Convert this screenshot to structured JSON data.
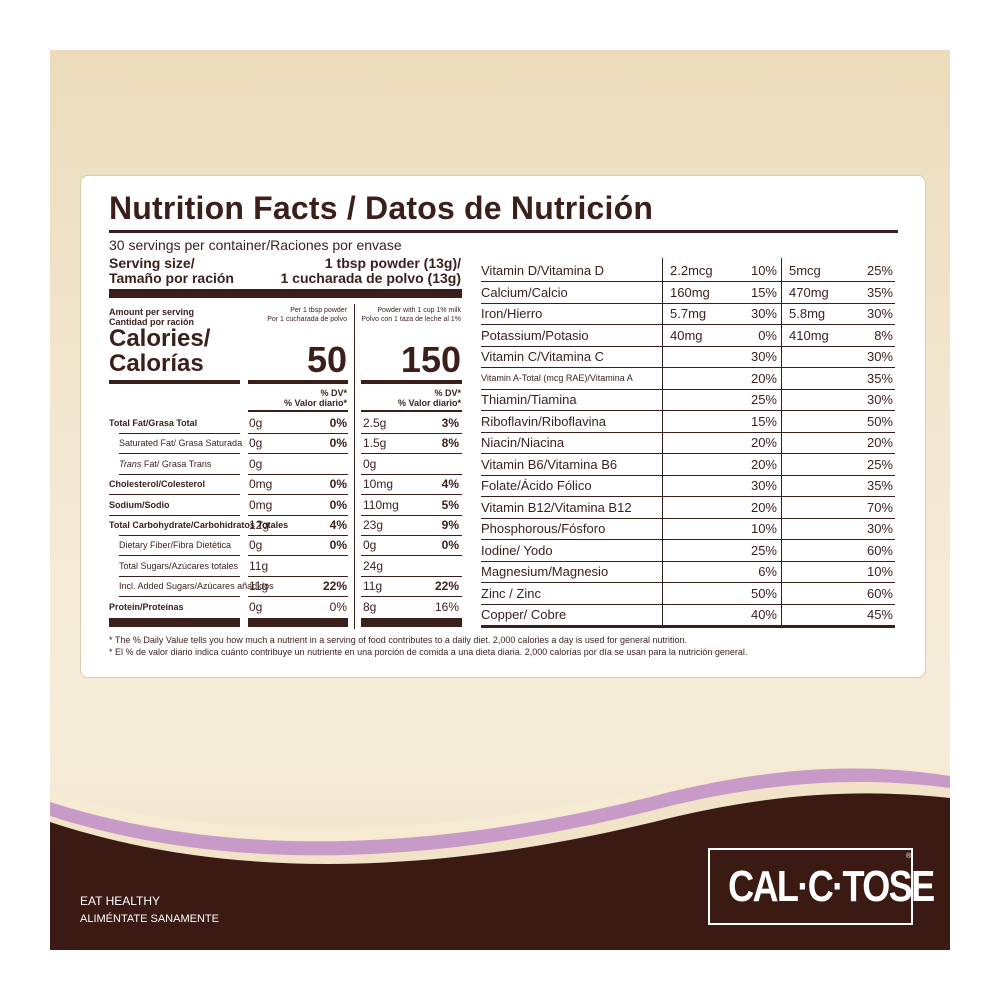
{
  "title": "Nutrition Facts / Datos de Nutrición",
  "servings": "30 servings per container/Raciones por envase",
  "serving_size_label": [
    "Serving size/",
    "Tamaño por ración"
  ],
  "serving_size_value": [
    "1 tbsp powder (13g)/",
    "1 cucharada de polvo (13g)"
  ],
  "amount_per_serving": [
    "Amount per serving",
    "Cantidad por ración"
  ],
  "col1_header": [
    "Per 1 tbsp powder",
    "Por 1 cucharada de polvo"
  ],
  "col2_header": [
    "Powder with 1 cup 1% milk",
    "Polvo con 1 taza de leche al 1%"
  ],
  "calories_label": [
    "Calories/",
    "Calorías"
  ],
  "calories": [
    "50",
    "150"
  ],
  "dv_header": [
    "% DV*",
    "% Valor diario*"
  ],
  "macros": [
    {
      "name": "Total Fat/Grasa Total",
      "bold": true,
      "indent": false,
      "v1": "0g",
      "p1": "0%",
      "v2": "2.5g",
      "p2": "3%",
      "pb": true
    },
    {
      "name": "Saturated Fat/ Grasa Saturada",
      "bold": false,
      "indent": true,
      "v1": "0g",
      "p1": "0%",
      "v2": "1.5g",
      "p2": "8%",
      "pb": true
    },
    {
      "name": "Trans Fat/ Grasa Trans",
      "bold": false,
      "indent": true,
      "v1": "0g",
      "p1": "",
      "v2": "0g",
      "p2": "",
      "pb": true
    },
    {
      "name": "Cholesterol/Colesterol",
      "bold": true,
      "indent": false,
      "v1": "0mg",
      "p1": "0%",
      "v2": "10mg",
      "p2": "4%",
      "pb": true
    },
    {
      "name": "Sodium/Sodio",
      "bold": true,
      "indent": false,
      "v1": "0mg",
      "p1": "0%",
      "v2": "110mg",
      "p2": "5%",
      "pb": true
    },
    {
      "name": "Total Carbohydrate/Carbohidratos Totales",
      "bold": true,
      "indent": false,
      "v1": "12g",
      "p1": "4%",
      "v2": "23g",
      "p2": "9%",
      "pb": true
    },
    {
      "name": "Dietary Fiber/Fibra Dietética",
      "bold": false,
      "indent": true,
      "v1": "0g",
      "p1": "0%",
      "v2": "0g",
      "p2": "0%",
      "pb": true
    },
    {
      "name": "Total Sugars/Azúcares totales",
      "bold": false,
      "indent": true,
      "v1": "11g",
      "p1": "",
      "v2": "24g",
      "p2": "",
      "pb": true
    },
    {
      "name": "Incl. Added Sugars/Azúcares añadidos",
      "bold": false,
      "indent": true,
      "v1": "11g",
      "p1": "22%",
      "v2": "11g",
      "p2": "22%",
      "pb": true
    },
    {
      "name": "Protein/Proteínas",
      "bold": true,
      "indent": false,
      "v1": "0g",
      "p1": "0%",
      "v2": "8g",
      "p2": "16%",
      "pb": false
    }
  ],
  "vitamins": [
    {
      "name": "Vitamin D/Vitamina D",
      "a1": "2.2mcg",
      "p1": "10%",
      "a2": "5mcg",
      "p2": "25%"
    },
    {
      "name": "Calcium/Calcio",
      "a1": "160mg",
      "p1": "15%",
      "a2": "470mg",
      "p2": "35%"
    },
    {
      "name": "Iron/Hierro",
      "a1": "5.7mg",
      "p1": "30%",
      "a2": "5.8mg",
      "p2": "30%"
    },
    {
      "name": "Potassium/Potasio",
      "a1": "40mg",
      "p1": "0%",
      "a2": "410mg",
      "p2": "8%"
    },
    {
      "name": "Vitamin C/Vitamina C",
      "a1": "",
      "p1": "30%",
      "a2": "",
      "p2": "30%"
    },
    {
      "name": "Vitamin A-Total (mcg RAE)/Vitamina A",
      "a1": "",
      "p1": "20%",
      "a2": "",
      "p2": "35%"
    },
    {
      "name": "Thiamin/Tiamina",
      "a1": "",
      "p1": "25%",
      "a2": "",
      "p2": "30%"
    },
    {
      "name": "Riboflavin/Riboflavina",
      "a1": "",
      "p1": "15%",
      "a2": "",
      "p2": "50%"
    },
    {
      "name": "Niacin/Niacina",
      "a1": "",
      "p1": "20%",
      "a2": "",
      "p2": "20%"
    },
    {
      "name": "Vitamin B6/Vitamina B6",
      "a1": "",
      "p1": "20%",
      "a2": "",
      "p2": "25%"
    },
    {
      "name": "Folate/Ácido Fólico",
      "a1": "",
      "p1": "30%",
      "a2": "",
      "p2": "35%"
    },
    {
      "name": "Vitamin B12/Vitamina B12",
      "a1": "",
      "p1": "20%",
      "a2": "",
      "p2": "70%"
    },
    {
      "name": "Phosphorous/Fósforo",
      "a1": "",
      "p1": "10%",
      "a2": "",
      "p2": "30%"
    },
    {
      "name": "Iodine/ Yodo",
      "a1": "",
      "p1": "25%",
      "a2": "",
      "p2": "60%"
    },
    {
      "name": "Magnesium/Magnesio",
      "a1": "",
      "p1": "6%",
      "a2": "",
      "p2": "10%"
    },
    {
      "name": "Zinc / Zinc",
      "a1": "",
      "p1": "50%",
      "a2": "",
      "p2": "60%"
    },
    {
      "name": "Copper/ Cobre",
      "a1": "",
      "p1": "40%",
      "a2": "",
      "p2": "45%"
    }
  ],
  "footnotes": [
    "* The % Daily Value tells you how much a nutrient in a serving of food contributes to a daily diet. 2,000 calories a day is used for general nutrition.",
    "* El % de valor diario indica cuánto contribuye un nutriente en una porción de comida a una dieta diaria. 2,000 calorías por día se usan para la nutrición general."
  ],
  "slogan": [
    "EAT HEALTHY",
    "ALIMÉNTATE SANAMENTE"
  ],
  "brand": "CAL·C·TOSE",
  "colors": {
    "text": "#3a1f1a",
    "band": "#3b1a14",
    "wave_purple": "#c89ac8",
    "background": "#ecdcbc"
  }
}
